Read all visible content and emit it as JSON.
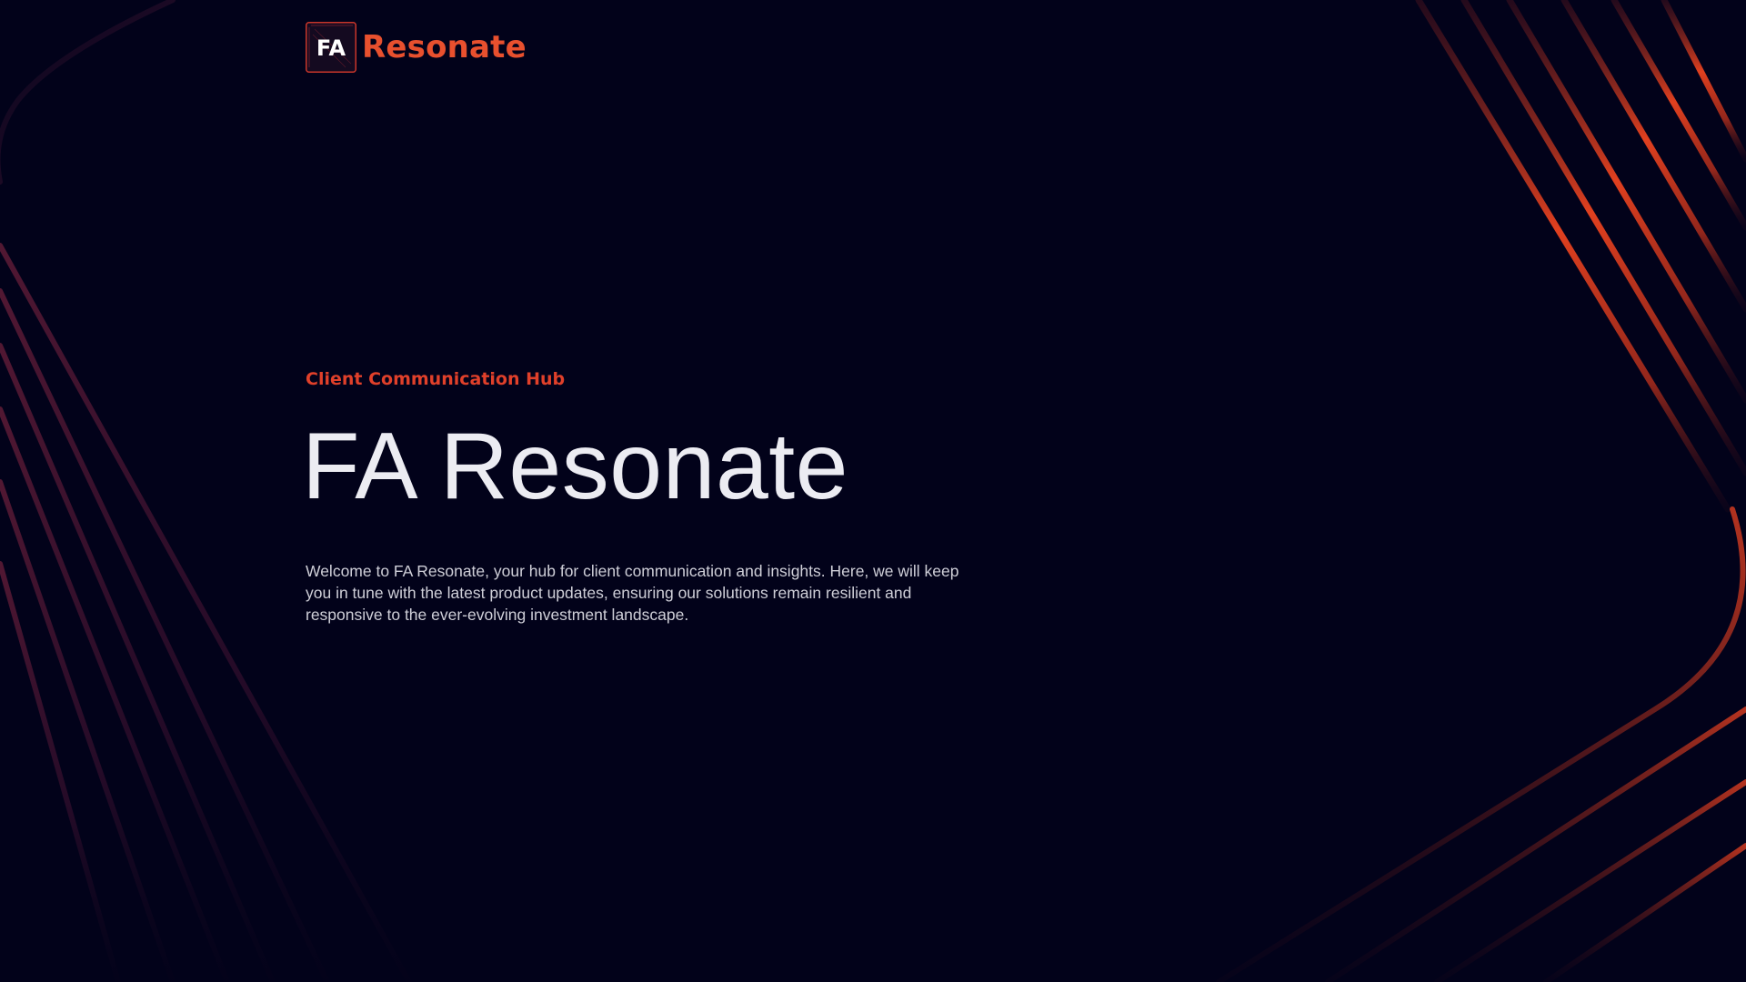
{
  "brand": {
    "logo_icon": "fa-monogram-icon",
    "logo_mark_text": "FA",
    "logo_wordmark": "Resonate",
    "accent_color": "#e8502e"
  },
  "hero": {
    "eyebrow": "Client Communication Hub",
    "title": "FA Resonate",
    "intro": "Welcome to FA Resonate, your hub for client communication and insights. Here, we will keep you in tune with the latest product updates, ensuring our solutions remain resilient and responsive to the ever-evolving investment landscape."
  },
  "theme": {
    "background": "#02021a",
    "accent": "#e0402a",
    "text_primary": "#ececf2",
    "text_secondary": "#cfcfd8"
  }
}
